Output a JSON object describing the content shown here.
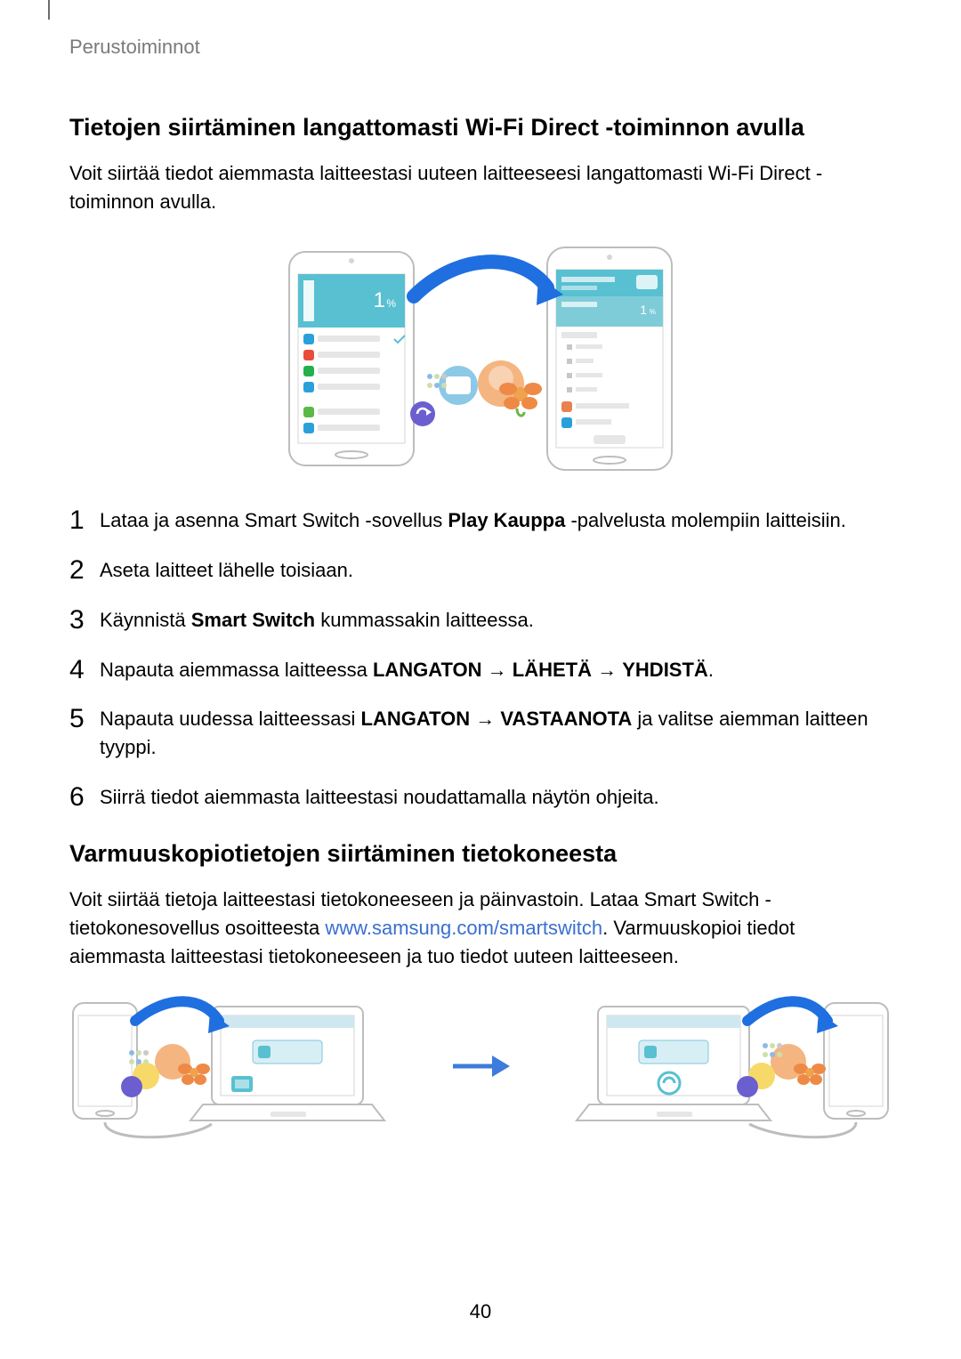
{
  "header": {
    "section_label": "Perustoiminnot"
  },
  "section1": {
    "heading": "Tietojen siirtäminen langattomasti Wi-Fi Direct -toiminnon avulla",
    "intro": "Voit siirtää tiedot aiemmasta laitteestasi uuteen laitteeseesi langattomasti Wi-Fi Direct -toiminnon avulla."
  },
  "steps": {
    "s1_pre": "Lataa ja asenna Smart Switch -sovellus ",
    "s1_bold": "Play Kauppa",
    "s1_post": " -palvelusta molempiin laitteisiin.",
    "s2": "Aseta laitteet lähelle toisiaan.",
    "s3_pre": "Käynnistä ",
    "s3_bold": "Smart Switch",
    "s3_post": " kummassakin laitteessa.",
    "s4_pre": "Napauta aiemmassa laitteessa ",
    "s4_b1": "LANGATON",
    "s4_arrow1": " → ",
    "s4_b2": "LÄHETÄ",
    "s4_arrow2": " → ",
    "s4_b3": "YHDISTÄ",
    "s4_post": ".",
    "s5_pre": "Napauta uudessa laitteessasi ",
    "s5_b1": "LANGATON",
    "s5_arrow1": " → ",
    "s5_b2": "VASTAANOTA",
    "s5_post": " ja valitse aiemman laitteen tyyppi.",
    "s6": "Siirrä tiedot aiemmasta laitteestasi noudattamalla näytön ohjeita.",
    "num1": "1",
    "num2": "2",
    "num3": "3",
    "num4": "4",
    "num5": "5",
    "num6": "6"
  },
  "section2": {
    "heading": "Varmuuskopiotietojen siirtäminen tietokoneesta",
    "p1_pre": "Voit siirtää tietoja laitteestasi tietokoneeseen ja päinvastoin. Lataa Smart Switch -tietokonesovellus osoitteesta ",
    "p1_link": "www.samsung.com/smartswitch",
    "p1_post": ". Varmuuskopioi tiedot aiemmasta laitteestasi tietokoneeseen ja tuo tiedot uuteen laitteeseen."
  },
  "illustration": {
    "percent": "1",
    "percent_suffix": "%"
  },
  "page_number": "40"
}
